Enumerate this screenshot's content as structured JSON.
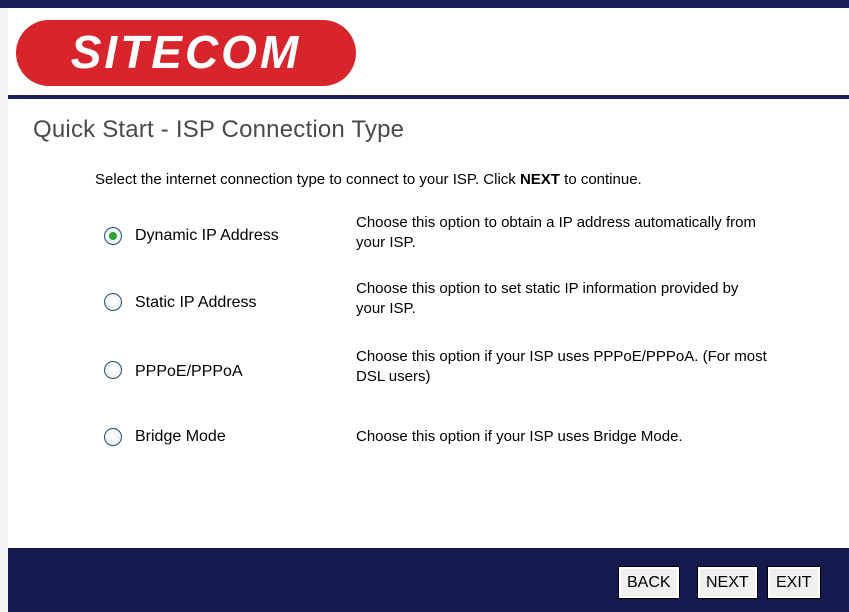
{
  "brand": {
    "logo_text": "SITECOM",
    "logo_color": "#d8242b",
    "nav_color": "#1a1f5c"
  },
  "page": {
    "title": "Quick Start - ISP Connection Type"
  },
  "instruction": {
    "prefix": "Select the internet connection type to connect to your ISP. Click ",
    "bold": "NEXT",
    "suffix": " to continue."
  },
  "options": [
    {
      "label": "Dynamic IP Address",
      "selected": true,
      "desc_line1": "Choose this option to obtain a IP address automatically from",
      "desc_line2": "your ISP."
    },
    {
      "label": "Static IP Address",
      "selected": false,
      "desc_line1": "Choose this option to set static IP information provided by",
      "desc_line2": "your ISP."
    },
    {
      "label": "PPPoE/PPPoA",
      "selected": false,
      "desc_line1": "Choose this option if your ISP uses PPPoE/PPPoA. (For most",
      "desc_line2": "DSL users)"
    },
    {
      "label": "Bridge Mode",
      "selected": false,
      "desc_line1": "Choose this option if your ISP uses Bridge Mode.",
      "desc_line2": ""
    }
  ],
  "buttons": {
    "back": "BACK",
    "next": "NEXT",
    "exit": "EXIT"
  }
}
